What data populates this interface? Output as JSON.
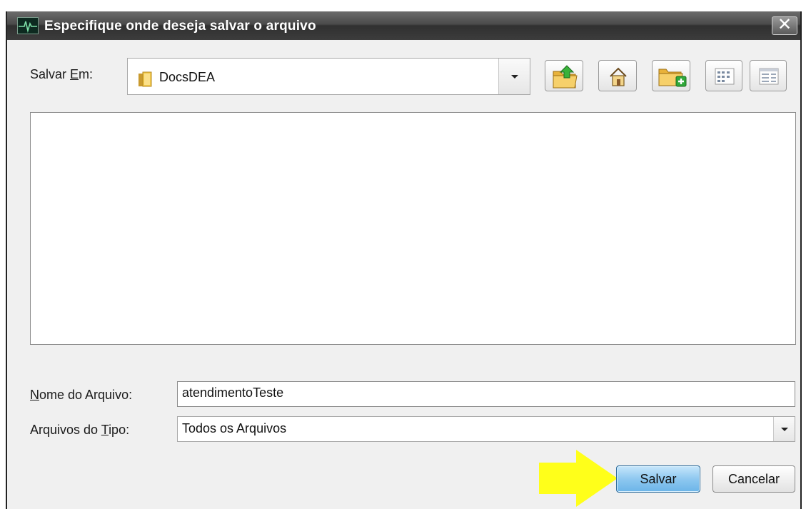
{
  "dialog": {
    "title": "Especifique onde deseja salvar o arquivo",
    "close_symbol": "✕",
    "icon": "app-heartbeat-icon"
  },
  "location": {
    "label_prefix": "Salvar ",
    "label_mnemonic": "E",
    "label_suffix": "m:",
    "selected_folder": "DocsDEA",
    "folder_icon": "folder-icon"
  },
  "toolbar": {
    "buttons": [
      {
        "name": "up-one-level-button",
        "icon": "folder-up-icon"
      },
      {
        "name": "home-button",
        "icon": "home-icon"
      },
      {
        "name": "new-folder-button",
        "icon": "new-folder-icon"
      },
      {
        "name": "list-view-button",
        "icon": "list-view-icon"
      },
      {
        "name": "details-view-button",
        "icon": "details-view-icon"
      }
    ]
  },
  "file_name": {
    "label_mnemonic": "N",
    "label_rest": "ome do Arquivo:",
    "value": "atendimentoTeste"
  },
  "file_type": {
    "label_prefix": "Arquivos do ",
    "label_mnemonic": "T",
    "label_suffix": "ipo:",
    "value": "Todos os Arquivos"
  },
  "actions": {
    "save_label": "Salvar",
    "cancel_label": "Cancelar"
  },
  "colors": {
    "highlight_arrow": "#ffff1a",
    "primary_button": "#8ec8f0"
  }
}
